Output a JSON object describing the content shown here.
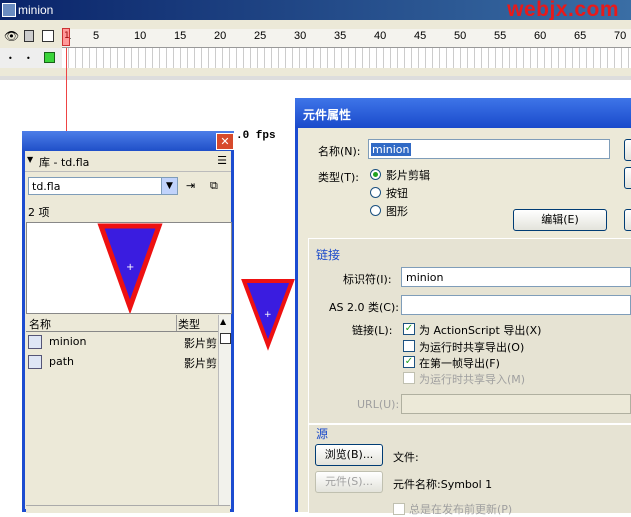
{
  "window": {
    "title": "minion",
    "watermark": "webjx.com"
  },
  "timeline": {
    "ruler_numbers": [
      "1",
      "5",
      "10",
      "15",
      "20",
      "25",
      "30",
      "35",
      "40",
      "45",
      "50",
      "55",
      "60",
      "65",
      "70"
    ],
    "fps_text": ".0 fps"
  },
  "library": {
    "title": "库 - td.fla",
    "file_combo": "td.fla",
    "item_count": "2 项",
    "col_name": "名称",
    "col_type": "类型",
    "items": [
      {
        "name": "minion",
        "type": "影片剪"
      },
      {
        "name": "path",
        "type": "影片剪"
      }
    ]
  },
  "dialog": {
    "title": "元件属性",
    "name_label": "名称(N):",
    "name_value": "minion",
    "type_label": "类型(T):",
    "type_options": [
      "影片剪辑",
      "按钮",
      "图形"
    ],
    "edit_button": "编辑(E)",
    "linkage_section": "链接",
    "identifier_label": "标识符(I):",
    "identifier_value": "minion",
    "as_class_label": "AS 2.0 类(C):",
    "linkage_label": "链接(L):",
    "linkage_options": [
      {
        "label": "为 ActionScript 导出(X)",
        "checked": true,
        "disabled": false
      },
      {
        "label": "为运行时共享导出(O)",
        "checked": false,
        "disabled": false
      },
      {
        "label": "在第一帧导出(F)",
        "checked": true,
        "disabled": false
      },
      {
        "label": "为运行时共享导入(M)",
        "checked": false,
        "disabled": true
      }
    ],
    "url_label": "URL(U):",
    "source_section": "源",
    "browse_button": "浏览(B)...",
    "file_label": "文件:",
    "symbol_button": "元件(S)...",
    "symbol_name_text": "元件名称:Symbol 1",
    "always_update": "总是在发布前更新(P)"
  },
  "colors": {
    "triangle_fill": "#3a1ce0",
    "triangle_stroke": "#ee1111",
    "accent": "#1a4acb"
  }
}
